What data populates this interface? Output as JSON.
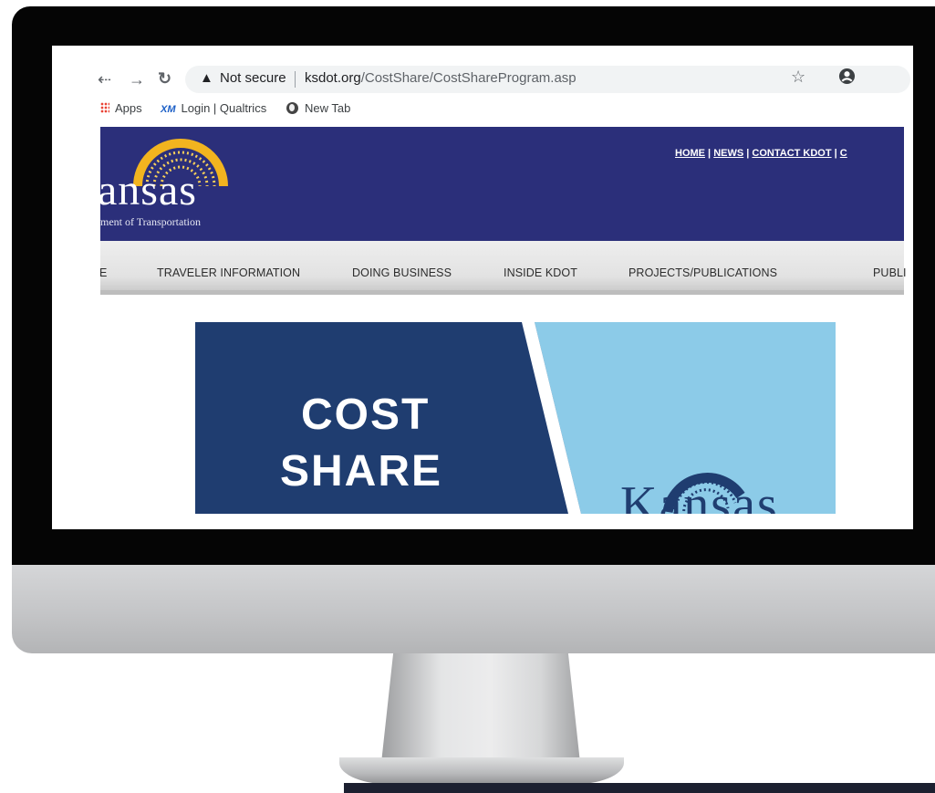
{
  "browser": {
    "back_icon": "back-arrow",
    "forward_icon": "forward-arrow",
    "reload_icon": "reload",
    "security_label": "Not secure",
    "url_domain": "ksdot.org",
    "url_path": "/CostShare/CostShareProgram.asp",
    "bookmark_icon": "star",
    "profile_icon": "account"
  },
  "bookmarks": [
    {
      "label": "Apps"
    },
    {
      "label": "Login | Qualtrics"
    },
    {
      "label": "New Tab"
    }
  ],
  "site": {
    "seal_text": "AD ASTRA PER ASPERA",
    "brand": "ansas",
    "subtitle": "ment of Transportation",
    "util_links": [
      "HOME",
      "NEWS",
      "CONTACT KDOT",
      "C"
    ],
    "nav": [
      "E",
      "TRAVELER INFORMATION",
      "DOING BUSINESS",
      "INSIDE KDOT",
      "PROJECTS/PUBLICATIONS",
      "PUBLI"
    ]
  },
  "banner": {
    "line1": "COST",
    "line2": "SHARE",
    "seal_text": "AD ASTRA PER ASPERA",
    "brand": "Kansas",
    "colors": {
      "dark": "#1f3d70",
      "light": "#8ccbe8"
    }
  },
  "colors": {
    "header": "#2b2f7a",
    "seal_gold": "#f2b41f"
  }
}
